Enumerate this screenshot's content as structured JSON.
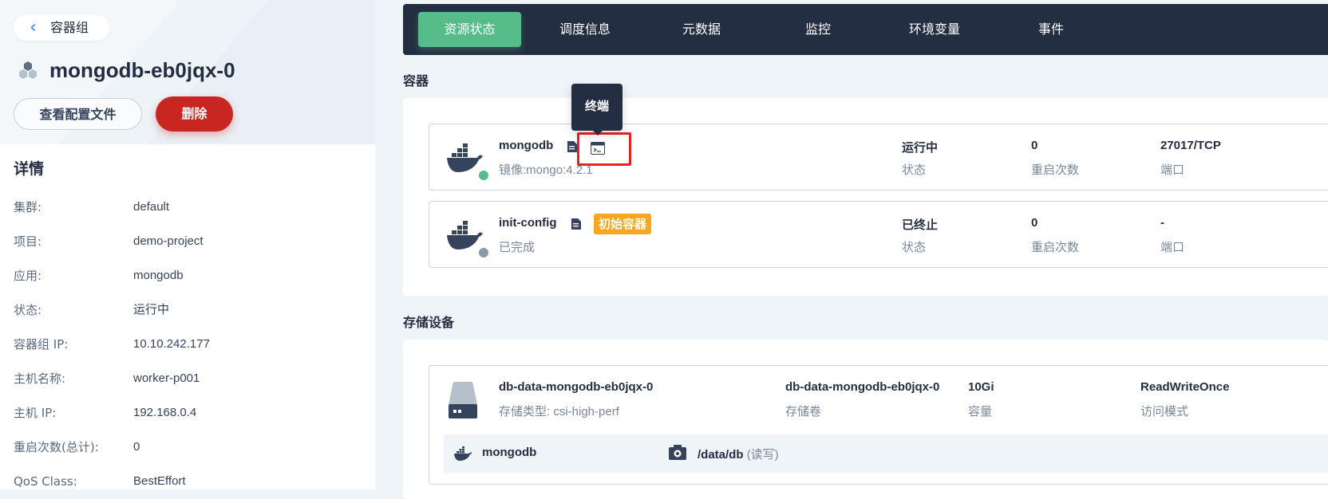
{
  "nav": {
    "back_label": "容器组"
  },
  "pod": {
    "name": "mongodb-eb0jqx-0",
    "view_config_label": "查看配置文件",
    "delete_label": "删除"
  },
  "details": {
    "heading": "详情",
    "rows": [
      {
        "key": "集群:",
        "value": "default"
      },
      {
        "key": "项目:",
        "value": "demo-project"
      },
      {
        "key": "应用:",
        "value": "mongodb"
      },
      {
        "key": "状态:",
        "value": "运行中"
      },
      {
        "key": "容器组 IP:",
        "value": "10.10.242.177"
      },
      {
        "key": "主机名称:",
        "value": "worker-p001"
      },
      {
        "key": "主机 IP:",
        "value": "192.168.0.4"
      },
      {
        "key": "重启次数(总计):",
        "value": "0"
      },
      {
        "key": "QoS Class:",
        "value": "BestEffort"
      }
    ]
  },
  "tabs": [
    "资源状态",
    "调度信息",
    "元数据",
    "监控",
    "环境变量",
    "事件"
  ],
  "containers_section": {
    "heading": "容器",
    "tooltip": "终端",
    "items": [
      {
        "name": "mongodb",
        "sub": "镜像:mongo:4.2.1",
        "status_value": "运行中",
        "status_label": "状态",
        "restarts_value": "0",
        "restarts_label": "重启次数",
        "port_value": "27017/TCP",
        "port_label": "端口",
        "dot_color": "#55bc8a"
      },
      {
        "name": "init-config",
        "badge": "初始容器",
        "sub": "已完成",
        "status_value": "已终止",
        "status_label": "状态",
        "restarts_value": "0",
        "restarts_label": "重启次数",
        "port_value": "-",
        "port_label": "端口",
        "dot_color": "#8c98a8"
      }
    ]
  },
  "storage_section": {
    "heading": "存储设备",
    "volume": {
      "name": "db-data-mongodb-eb0jqx-0",
      "sub": "存储类型: csi-high-perf",
      "volume_value": "db-data-mongodb-eb0jqx-0",
      "volume_label": "存储卷",
      "capacity_value": "10Gi",
      "capacity_label": "容量",
      "access_value": "ReadWriteOnce",
      "access_label": "访问模式"
    },
    "mount": {
      "container": "mongodb",
      "path": "/data/db",
      "mode": "(读写)"
    }
  },
  "colors": {
    "accent_green": "#55bc8a",
    "danger_red": "#ca2621",
    "dark_nav": "#242e42",
    "badge_orange": "#f5a623"
  }
}
